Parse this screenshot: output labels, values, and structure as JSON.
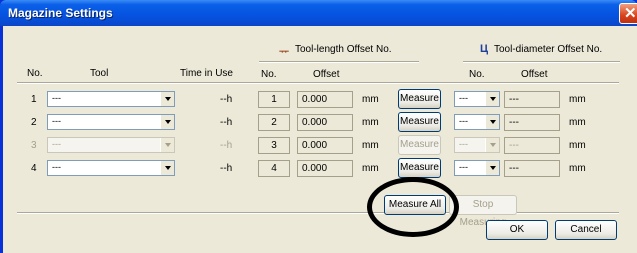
{
  "window": {
    "title": "Magazine Settings"
  },
  "headers": {
    "length_group": "Tool-length Offset No.",
    "diameter_group": "Tool-diameter Offset No.",
    "no": "No.",
    "tool": "Tool",
    "time_in_use": "Time in Use",
    "len_no": "No.",
    "len_offset": "Offset",
    "dia_no": "No.",
    "dia_offset": "Offset"
  },
  "rows": [
    {
      "no": "1",
      "tool": "---",
      "time": "--h",
      "len_no": "1",
      "len_offset": "0.000",
      "unit": "mm",
      "measure": "Measure",
      "dia_no": "---",
      "dia_offset": "---",
      "dia_unit": "mm",
      "disabled": false
    },
    {
      "no": "2",
      "tool": "---",
      "time": "--h",
      "len_no": "2",
      "len_offset": "0.000",
      "unit": "mm",
      "measure": "Measure",
      "dia_no": "---",
      "dia_offset": "---",
      "dia_unit": "mm",
      "disabled": false
    },
    {
      "no": "3",
      "tool": "---",
      "time": "--h",
      "len_no": "3",
      "len_offset": "0.000",
      "unit": "mm",
      "measure": "Measure",
      "dia_no": "---",
      "dia_offset": "---",
      "dia_unit": "mm",
      "disabled": true
    },
    {
      "no": "4",
      "tool": "---",
      "time": "--h",
      "len_no": "4",
      "len_offset": "0.000",
      "unit": "mm",
      "measure": "Measure",
      "dia_no": "---",
      "dia_offset": "---",
      "dia_unit": "mm",
      "disabled": false
    }
  ],
  "buttons": {
    "measure_all": "Measure All",
    "stop_measuring": "Stop Measuring",
    "ok": "OK",
    "cancel": "Cancel"
  },
  "icons": {
    "close": "close-icon",
    "length": "tool-length-icon",
    "diameter": "tool-diameter-icon"
  },
  "colors": {
    "titlebar": "#0553e0",
    "dialog_bg": "#ece9d8",
    "length_icon": "#a0522d",
    "diameter_icon": "#1f3f9f"
  }
}
